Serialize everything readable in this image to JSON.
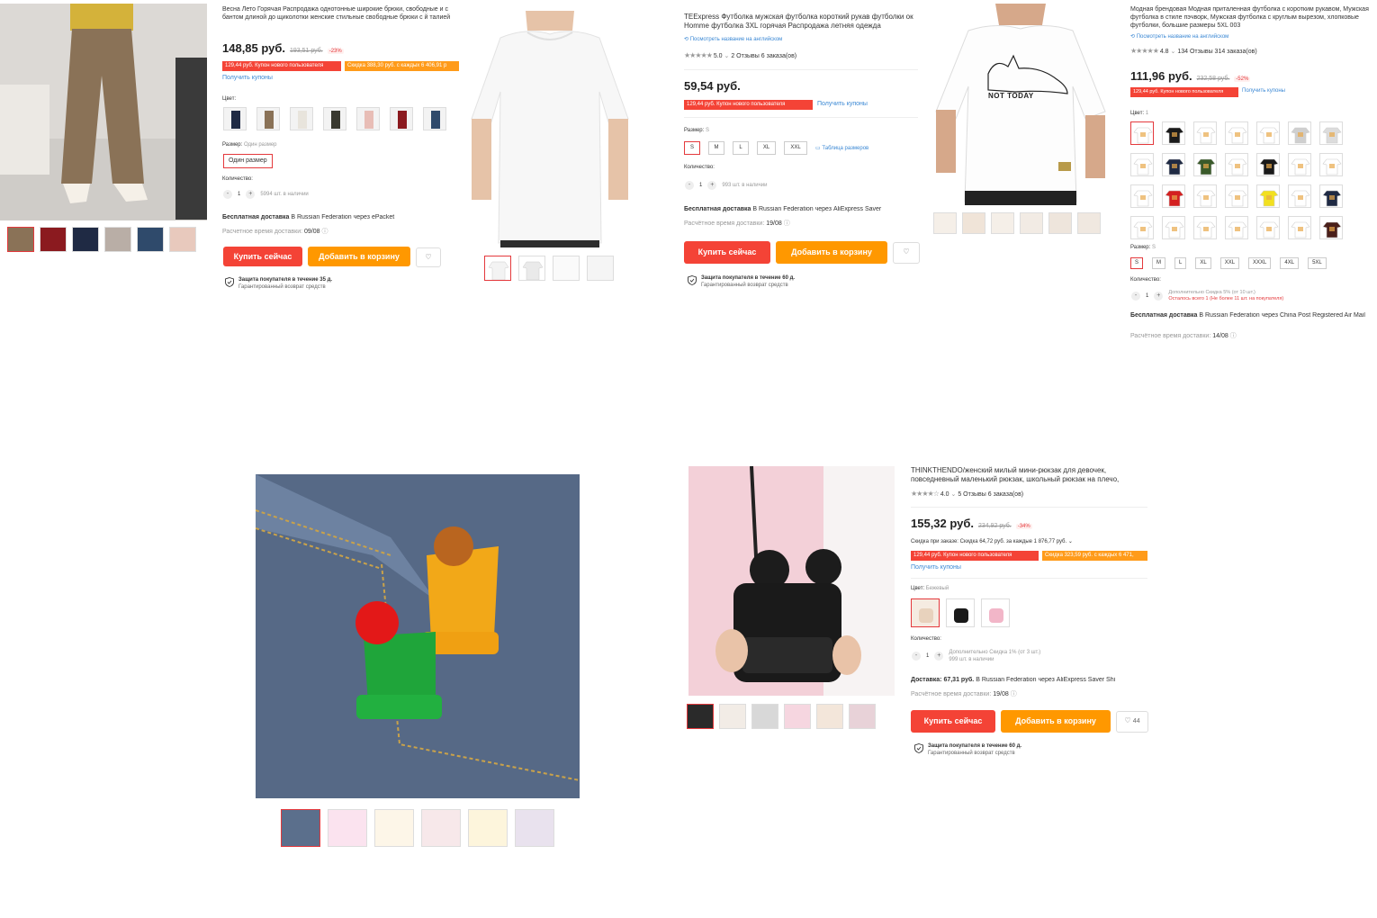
{
  "p1": {
    "title": "Весна Лето Горячая Распродажа однотонные широкие брюки, свободные и с бантом длиной до щиколотки женские стильные свободные брюки с й талией",
    "price": "148,85 руб.",
    "old_price": "193,51 руб.",
    "discount": "-23%",
    "coupon_new_user": "129,44 руб. Купон нового пользователя",
    "coupon_discount": "Скидка 388,30 руб. с каждых 6 406,91 р",
    "get_coupons": "Получить купоны",
    "color_label": "Цвет:",
    "size_label": "Размер:",
    "size_value": "Один размер",
    "size_button": "Один размер",
    "qty_label": "Количество:",
    "qty_minus": "-",
    "qty_value": "1",
    "qty_plus": "+",
    "stock": "5994 шт. в наличии",
    "ship_bold": "Бесплатная доставка",
    "ship_rest": " В Russian Federation через ePacket",
    "eta_label": "Расчетное время доставки:",
    "eta_date": "09/08",
    "buy": "Купить сейчас",
    "cart": "Добавить в корзину",
    "wish_icon": "heart-icon",
    "protect_title": "Защита покупателя в течение 35 д.",
    "protect_sub": "Гарантированный возврат средств"
  },
  "p2": {
    "title": "TEExpress Футболка мужская футболка короткий рукав футболки ок Homme футболка 3XL горячая Распродажа летняя одежда",
    "translate": "Посмотреть название на английском",
    "stars": "★★★★★",
    "rating": "5.0",
    "reviews": "2 Отзывы",
    "orders": "6 заказа(ов)",
    "price": "59,54 руб.",
    "coupon_new_user": "129,44 руб. Купон нового пользователя",
    "get_coupons": "Получить купоны",
    "size_label": "Размер:",
    "size_value": "S",
    "sizes": [
      "S",
      "M",
      "L",
      "XL",
      "XXL"
    ],
    "size_chart": "Таблица размеров",
    "qty_label": "Количество:",
    "qty_minus": "-",
    "qty_value": "1",
    "qty_plus": "+",
    "stock": "993 шт. в наличии",
    "ship_bold": "Бесплатная доставка",
    "ship_rest": " В Russian Federation через AliExpress Saver",
    "eta_label": "Расчётное время доставки:",
    "eta_date": "19/08",
    "buy": "Купить сейчас",
    "cart": "Добавить в корзину",
    "protect_title": "Защита покупателя в течение 60 д.",
    "protect_sub": "Гарантированный возврат средств"
  },
  "p3": {
    "title": "Модная брендовая Модная приталенная футболка с коротким рукавом, Мужская футболка в стиле пэчворк, Мужская футболка с круглым вырезом, хлопковые футболки, большие размеры 5XL 003",
    "translate": "Посмотреть название на английском",
    "stars": "★★★★★",
    "rating": "4.8",
    "reviews": "134 Отзывы",
    "orders": "314 заказа(ов)",
    "price": "111,96 руб.",
    "old_price": "232,58 руб.",
    "discount": "-52%",
    "coupon_new_user": "129,44 руб. Купон нового пользователя",
    "get_coupons": "Получить купоны",
    "color_label": "Цвет:",
    "color_value": "1",
    "print_text": "NOT TODAY",
    "size_label": "Размер:",
    "size_value": "S",
    "sizes": [
      "S",
      "M",
      "L",
      "XL",
      "XXL",
      "XXXL",
      "4XL",
      "5XL"
    ],
    "qty_label": "Количество:",
    "qty_minus": "-",
    "qty_value": "1",
    "qty_plus": "+",
    "extra_discount": "Дополнительно Скидка 5% (от 10 шт.)",
    "stock_left": "Осталось всего 1 (Не более 11 шт. на покупателя)",
    "ship_bold": "Бесплатная доставка",
    "ship_rest": " В Russian Federation через China Post Registered Air Mail",
    "eta_label": "Расчётное время доставки:",
    "eta_date": "14/08"
  },
  "p5": {
    "title": "THINKTHENDO/женский милый мини-рюкзак для девочек, повседневный маленький рюкзак, школьный рюкзак на плечо, дорожная сумка",
    "stars": "★★★★☆",
    "rating": "4.0",
    "reviews": "5 Отзывы",
    "orders": "6 заказа(ов)",
    "price": "155,32 руб.",
    "old_price": "234,92 руб.",
    "discount": "-34%",
    "order_discount": "Скидка при заказе: Скидка 64,72 руб. за каждые 1 876,77 руб.",
    "coupon_new_user": "129,44 руб. Купон нового пользователя",
    "coupon_discount": "Скидка 323,59 руб. с каждых 6 471,",
    "get_coupons": "Получить купоны",
    "color_label": "Цвет:",
    "color_value": "Бежевый",
    "qty_label": "Количество:",
    "qty_minus": "-",
    "qty_value": "1",
    "qty_plus": "+",
    "extra_discount": "Дополнительно Скидка 1% (от 3 шт.)",
    "stock": "999 шт. в наличии",
    "ship_bold": "Доставка: 67,31 руб.",
    "ship_rest": " В Russian Federation через AliExpress Saver Shi",
    "eta_label": "Расчётное время доставки:",
    "eta_date": "19/08",
    "buy": "Купить сейчас",
    "cart": "Добавить в корзину",
    "wish_count": "44",
    "protect_title": "Защита покупателя в течение 60 д.",
    "protect_sub": "Гарантированный возврат средств"
  },
  "colors": {
    "accent_red": "#f44336",
    "accent_orange": "#ff9800",
    "link_blue": "#3b88d4"
  }
}
